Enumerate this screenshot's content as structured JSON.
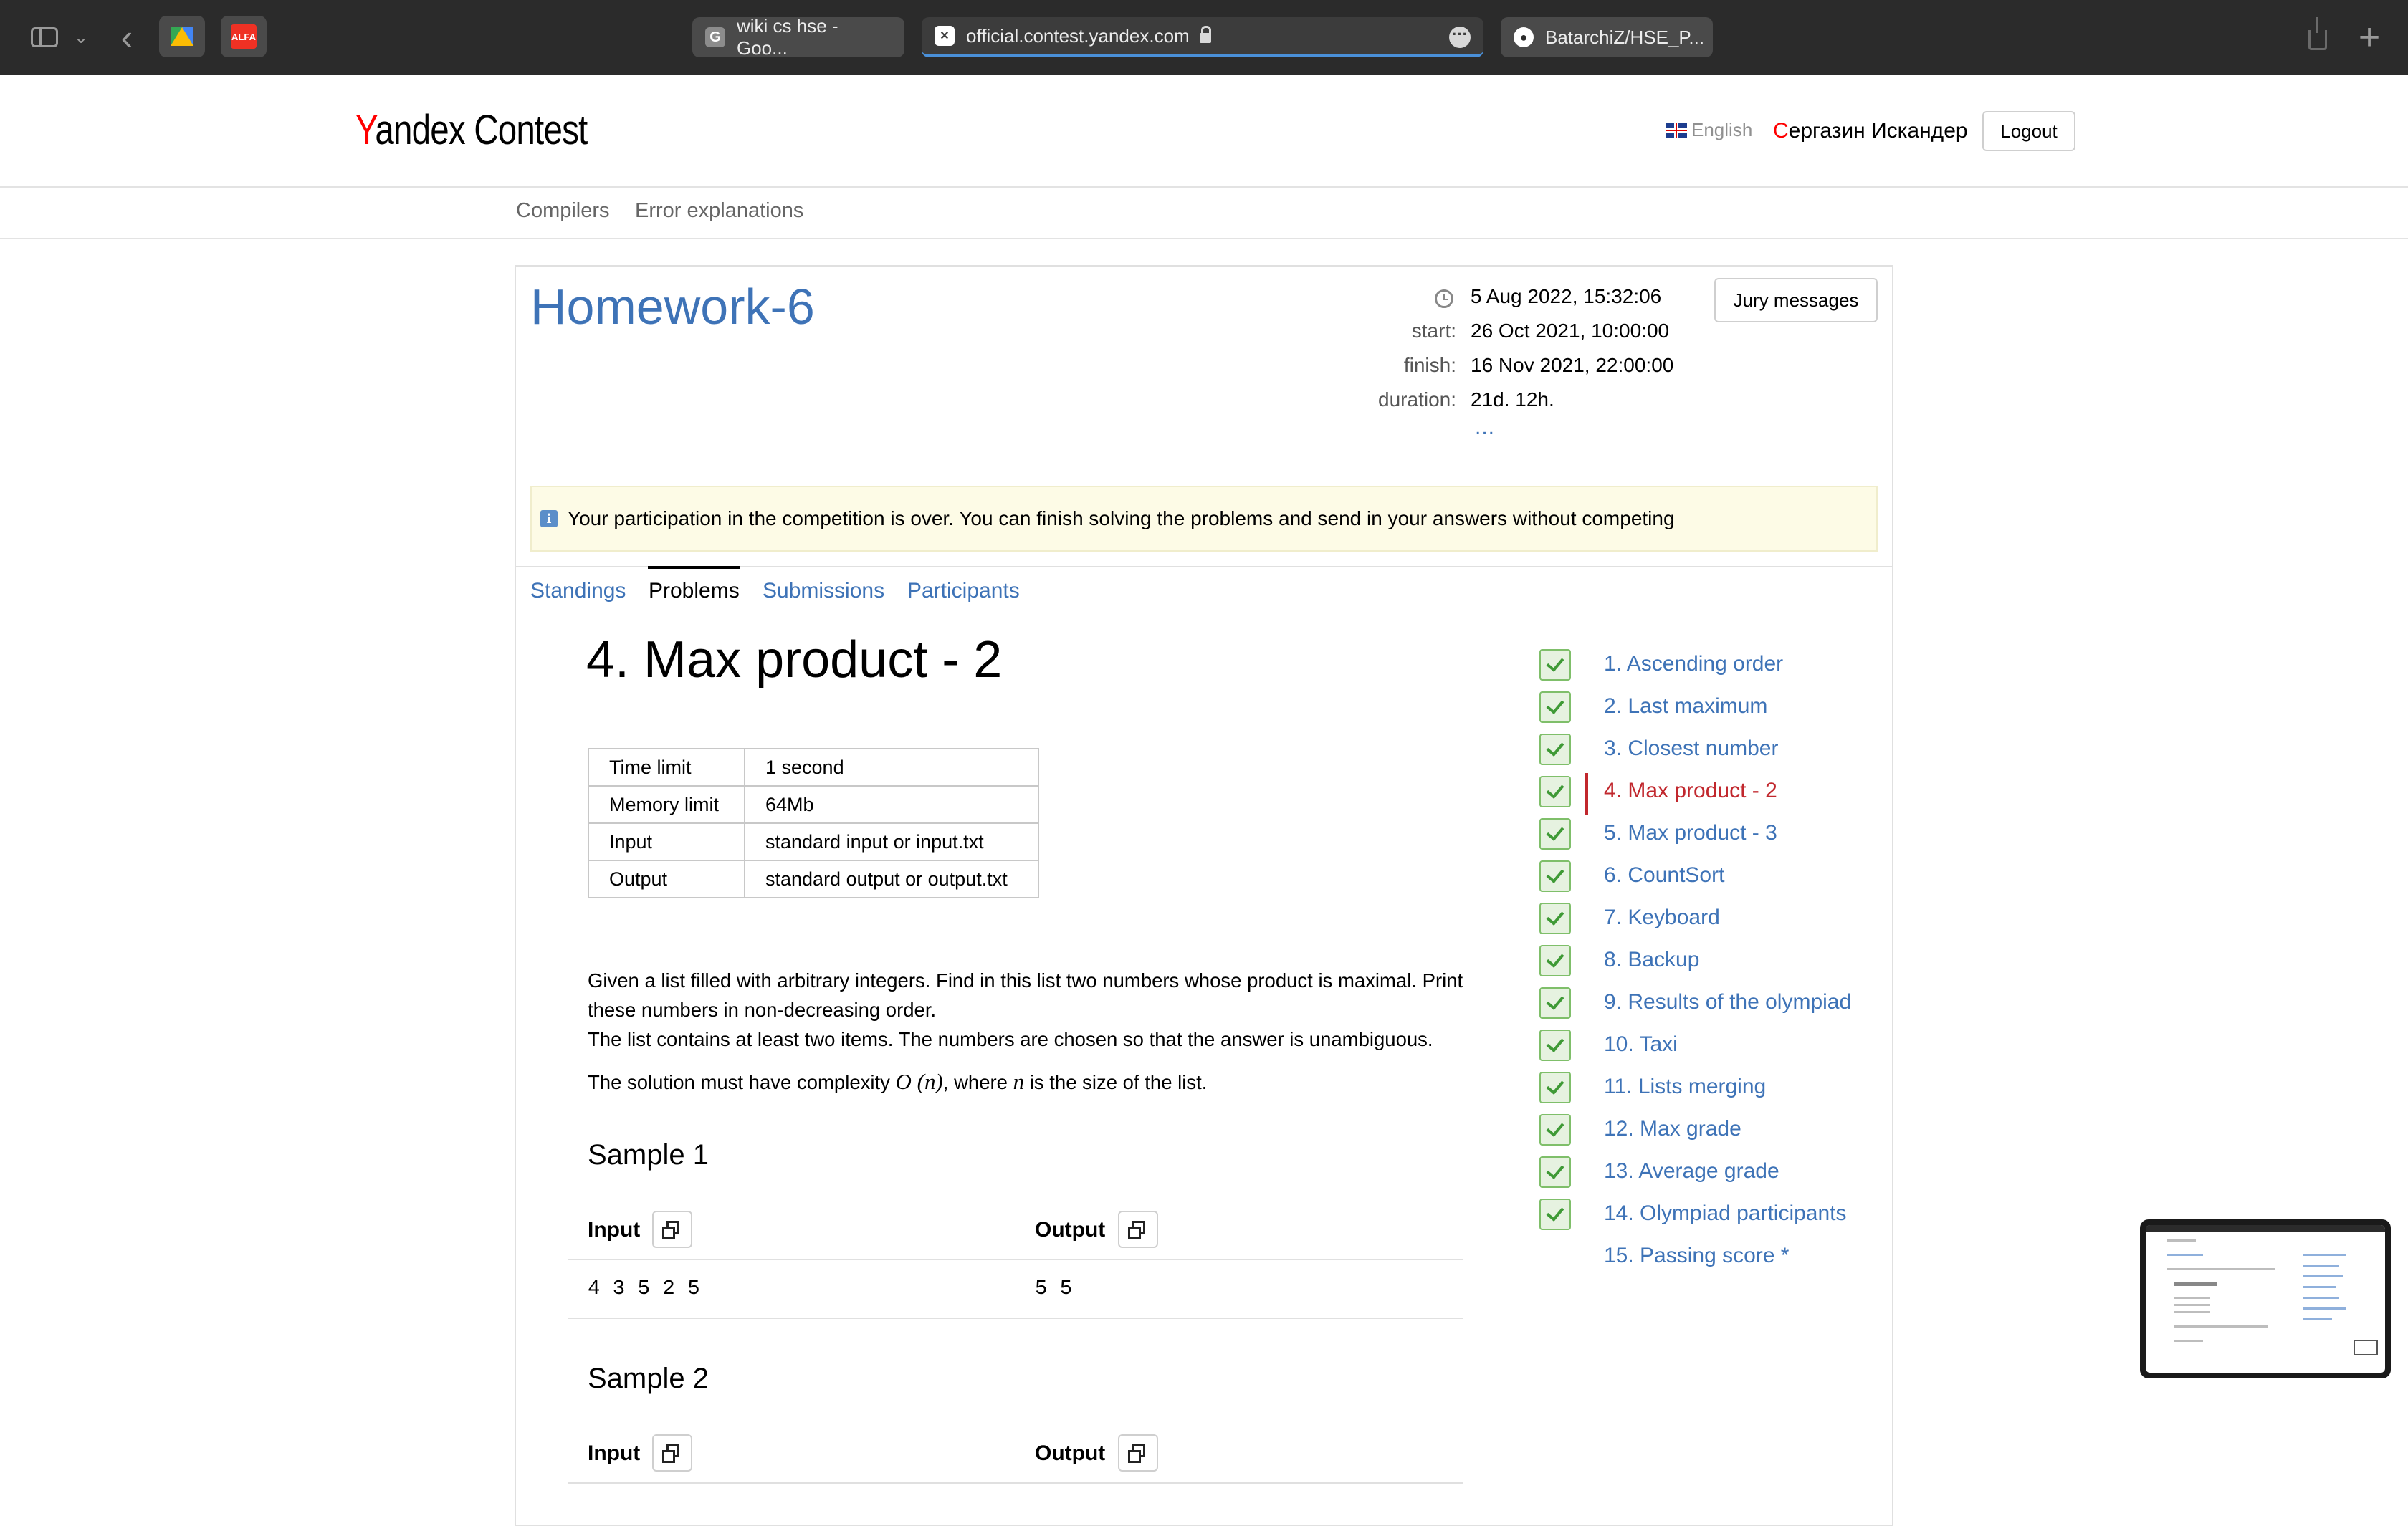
{
  "browser": {
    "tabs": [
      {
        "favicon": "G",
        "title": "wiki cs hse - Goo..."
      },
      {
        "favicon": "✕",
        "title": "official.contest.yandex.com"
      },
      {
        "favicon": "github-icon",
        "title": "BatarchiZ/HSE_P..."
      }
    ],
    "pinned": [
      {
        "name": "google-drive",
        "label": ""
      },
      {
        "name": "alfa-bank",
        "label": "ALFA"
      }
    ]
  },
  "site": {
    "logo_first": "Y",
    "logo_rest": "andex",
    "logo_second": " Contest",
    "language": "English",
    "user_first": "С",
    "user_rest": "ергазин Искандер",
    "logout": "Logout",
    "nav": [
      "Compilers",
      "Error explanations"
    ]
  },
  "contest": {
    "title": "Homework-6",
    "current_time": "5 Aug 2022, 15:32:06",
    "start_label": "start:",
    "start": "26 Oct 2021, 10:00:00",
    "finish_label": "finish:",
    "finish": "16 Nov 2021, 22:00:00",
    "duration_label": "duration:",
    "duration": "21d. 12h.",
    "more": "...",
    "jury_button": "Jury messages",
    "notice": "Your participation in the competition is over. You can finish solving the problems and send in your answers without competing",
    "tabs": [
      "Standings",
      "Problems",
      "Submissions",
      "Participants"
    ],
    "active_tab": "Problems"
  },
  "problem": {
    "title": "4. Max product - 2",
    "limits": [
      {
        "key": "Time limit",
        "value": "1 second"
      },
      {
        "key": "Memory limit",
        "value": "64Mb"
      },
      {
        "key": "Input",
        "value": "standard input or input.txt"
      },
      {
        "key": "Output",
        "value": "standard output or output.txt"
      }
    ],
    "statement_p1": "Given a list filled with arbitrary integers. Find in this list two numbers whose product is maximal. Print these numbers in non-decreasing order.",
    "statement_p2": "The list contains at least two items. The numbers are chosen so that the answer is unambiguous.",
    "statement_p3_a": "The solution must have complexity ",
    "statement_p3_math": "O (n)",
    "statement_p3_b": ", where ",
    "statement_p3_n": "n",
    "statement_p3_c": " is the size of the list.",
    "samples": [
      {
        "title": "Sample 1",
        "input_label": "Input",
        "output_label": "Output",
        "input": "4 3 5 2 5",
        "output": "5 5"
      },
      {
        "title": "Sample 2",
        "input_label": "Input",
        "output_label": "Output"
      }
    ]
  },
  "problem_list": [
    {
      "label": "1. Ascending order",
      "solved": true
    },
    {
      "label": "2. Last maximum",
      "solved": true
    },
    {
      "label": "3. Closest number",
      "solved": true
    },
    {
      "label": "4. Max product - 2",
      "solved": true,
      "current": true
    },
    {
      "label": "5. Max product - 3",
      "solved": true
    },
    {
      "label": "6. CountSort",
      "solved": true
    },
    {
      "label": "7. Keyboard",
      "solved": true
    },
    {
      "label": "8. Backup",
      "solved": true
    },
    {
      "label": "9. Results of the olympiad",
      "solved": true
    },
    {
      "label": "10. Taxi",
      "solved": true
    },
    {
      "label": "11. Lists merging",
      "solved": true
    },
    {
      "label": "12. Max grade",
      "solved": true
    },
    {
      "label": "13. Average grade",
      "solved": true
    },
    {
      "label": "14. Olympiad participants",
      "solved": true
    },
    {
      "label": "15. Passing score *",
      "solved": false
    }
  ]
}
